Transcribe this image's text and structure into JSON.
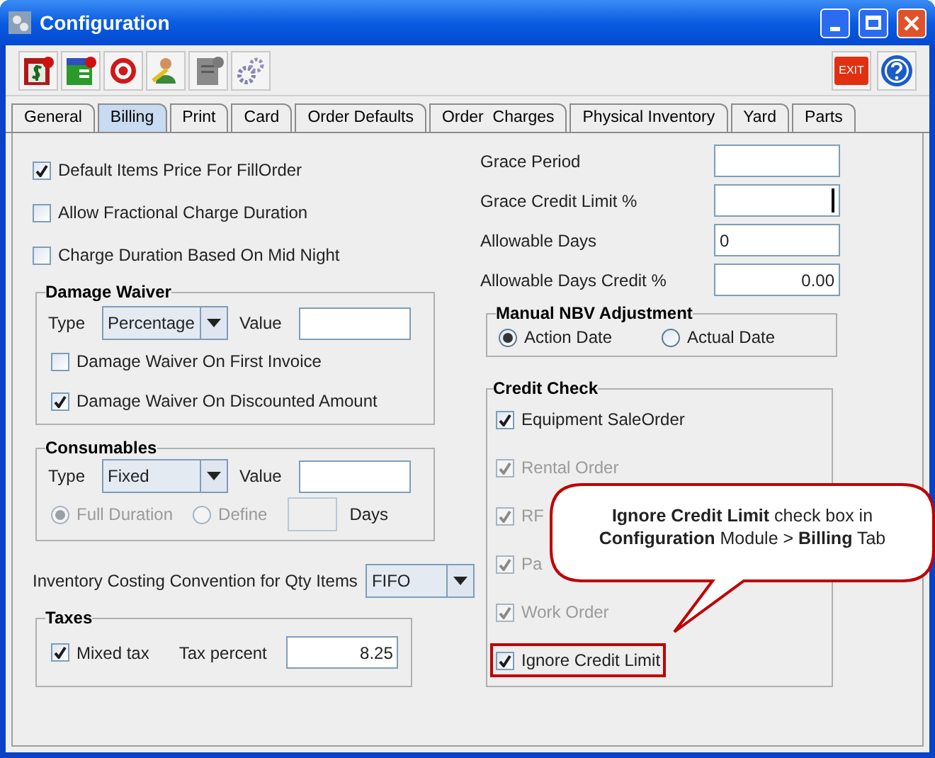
{
  "window": {
    "title": "Configuration"
  },
  "toolbar": {
    "exit_label": "EXIT"
  },
  "tabs": [
    {
      "label": "General",
      "selected": false
    },
    {
      "label": "Billing",
      "selected": true
    },
    {
      "label": "Print",
      "selected": false
    },
    {
      "label": "Card",
      "selected": false
    },
    {
      "label": "Order Defaults",
      "selected": false
    },
    {
      "label": "Order  Charges",
      "selected": false
    },
    {
      "label": "Physical Inventory",
      "selected": false
    },
    {
      "label": "Yard",
      "selected": false
    },
    {
      "label": "Parts",
      "selected": false
    }
  ],
  "options": [
    {
      "label": "Default Items Price For FillOrder",
      "checked": true
    },
    {
      "label": "Allow Fractional Charge Duration",
      "checked": false
    },
    {
      "label": "Charge Duration Based On Mid Night",
      "checked": false
    }
  ],
  "damage_waiver": {
    "title": "Damage Waiver",
    "type_label": "Type",
    "type_value": "Percentage",
    "value_label": "Value",
    "options": [
      {
        "label": "Damage Waiver On First Invoice",
        "checked": false
      },
      {
        "label": "Damage Waiver On Discounted Amount",
        "checked": true
      }
    ]
  },
  "consumables": {
    "title": "Consumables",
    "type_label": "Type",
    "type_value": "Fixed",
    "value_label": "Value",
    "duration": [
      {
        "label": "Full Duration",
        "selected": true
      },
      {
        "label": "Define",
        "selected": false
      }
    ],
    "duration_disabled": true,
    "days_label": "Days"
  },
  "inventory_costing": {
    "label": "Inventory Costing Convention for Qty Items",
    "value": "FIFO"
  },
  "taxes": {
    "title": "Taxes",
    "mixed_tax": {
      "label": "Mixed tax",
      "checked": true
    },
    "tax_percent_label": "Tax percent",
    "tax_percent": "8.25"
  },
  "credit_fields": [
    {
      "label": "Grace Period",
      "kind": "text",
      "focused": false
    },
    {
      "label": "Grace Credit Limit %",
      "kind": "text",
      "focused": true
    },
    {
      "label": "Allowable Days",
      "kind": "text",
      "value": "0",
      "focused": false
    },
    {
      "label": "Allowable Days Credit %",
      "kind": "number",
      "value": "0.00",
      "focused": false
    }
  ],
  "manual_nbv": {
    "title": "Manual NBV Adjustment",
    "options": [
      {
        "label": "Action Date",
        "selected": true
      },
      {
        "label": "Actual Date",
        "selected": false
      }
    ]
  },
  "credit_check": {
    "title": "Credit Check",
    "items": [
      {
        "label": "Equipment SaleOrder",
        "checked": true,
        "disabled": false,
        "highlighted": false
      },
      {
        "label": "Rental Order",
        "checked": true,
        "disabled": true,
        "highlighted": false
      },
      {
        "label": "RF",
        "checked": true,
        "disabled": true,
        "highlighted": false
      },
      {
        "label": "Pa",
        "checked": true,
        "disabled": true,
        "highlighted": false
      },
      {
        "label": "Work Order",
        "checked": true,
        "disabled": true,
        "highlighted": false
      },
      {
        "label": "Ignore Credit Limit",
        "checked": true,
        "disabled": false,
        "highlighted": true
      }
    ]
  },
  "callout": {
    "text": "**Ignore Credit Limit** check box in **Configuration** Module > **Billing** Tab"
  }
}
